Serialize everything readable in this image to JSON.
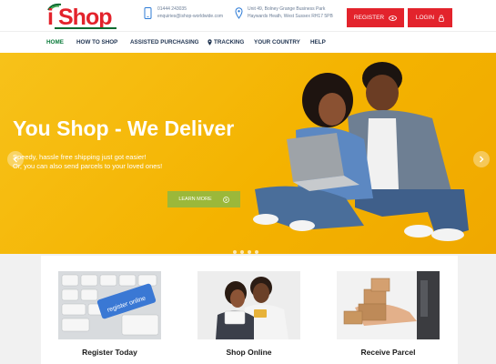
{
  "header": {
    "logo_i": "i",
    "logo_text": "Shop",
    "phone": "01444 243035",
    "email": "enquiries@ishop-worldwide.com",
    "address_line1": "Unit 49, Bolney Grange Business Park",
    "address_line2": "Haywards Heath, West Sussex RH17 5PB",
    "register_label": "REGISTER",
    "login_label": "LOGIN"
  },
  "nav": {
    "items": [
      "HOME",
      "HOW TO SHOP",
      "ASSISTED PURCHASING",
      "TRACKING",
      "YOUR COUNTRY",
      "HELP"
    ]
  },
  "hero": {
    "title": "You Shop - We Deliver",
    "subtitle_line1": "Speedy, hassle free shipping just got easier!",
    "subtitle_line2": "Or, you can also send parcels to your loved ones!",
    "button_label": "LEARN MORE"
  },
  "cards": [
    {
      "title": "Register Today"
    },
    {
      "title": "Shop Online"
    },
    {
      "title": "Receive Parcel"
    }
  ],
  "colors": {
    "brand_red": "#e3232c",
    "brand_green": "#0a7a3a",
    "hero_yellow": "#f4b300",
    "learn_more_green": "#9bb83a"
  }
}
